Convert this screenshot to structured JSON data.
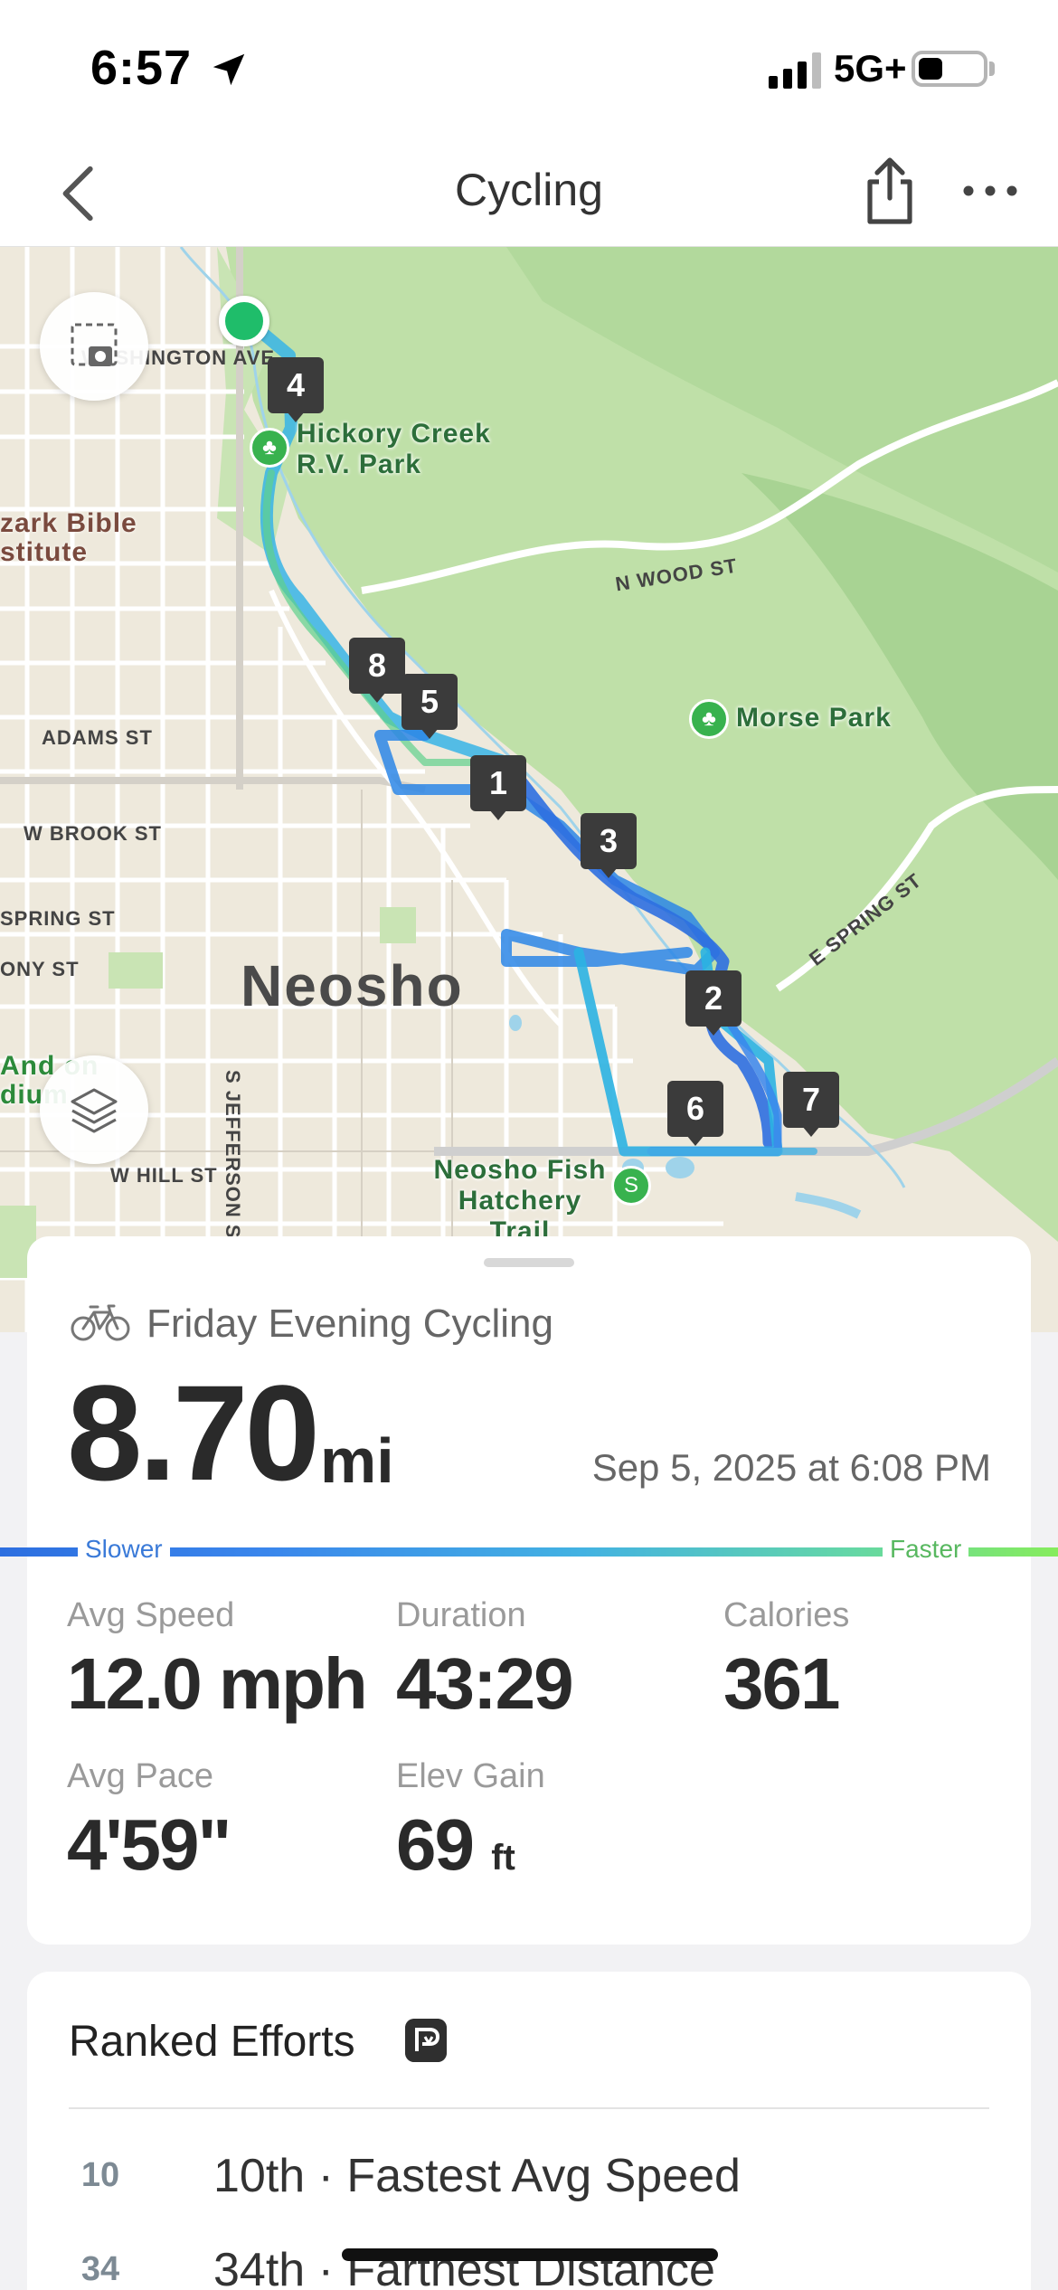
{
  "status_bar": {
    "time": "6:57",
    "network": "5G+"
  },
  "nav": {
    "title": "Cycling",
    "icons": [
      "chevron-left-icon",
      "share-icon",
      "more-icon"
    ]
  },
  "map": {
    "streets": [
      "WASHINGTON AVE",
      "N WOOD ST",
      "ADAMS ST",
      "W BROOK ST",
      "SPRING ST",
      "ONY ST",
      "W HILL ST",
      "S JEFFERSON S",
      "E SPRING ST"
    ],
    "city": "Neosho",
    "pois": [
      "Hickory Creek R.V. Park",
      "Morse Park",
      "Neosho Fish Hatchery Trail"
    ],
    "institution": "zark Bible stitute",
    "institution2": "And on dium",
    "lap_markers": [
      "4",
      "8",
      "5",
      "1",
      "3",
      "2",
      "6",
      "7"
    ],
    "icons": [
      "screenshot-icon",
      "layers-icon"
    ]
  },
  "summary": {
    "activity_name": "Friday Evening Cycling",
    "distance": "8.70",
    "distance_unit": "mi",
    "date": "Sep 5, 2025 at 6:08 PM",
    "legend_slower": "Slower",
    "legend_faster": "Faster",
    "stats": {
      "avg_speed": {
        "label": "Avg Speed",
        "value": "12.0 mph"
      },
      "duration": {
        "label": "Duration",
        "value": "43:29"
      },
      "calories": {
        "label": "Calories",
        "value": "361"
      },
      "avg_pace": {
        "label": "Avg Pace",
        "value": "4'59\""
      },
      "elev_gain": {
        "label": "Elev Gain",
        "value": "69",
        "unit": "ft"
      }
    }
  },
  "ranked": {
    "title": "Ranked Efforts",
    "items": [
      {
        "rank": "10",
        "text": "10th · Fastest Avg Speed"
      },
      {
        "rank": "34",
        "text": "34th · Farthest Distance"
      }
    ]
  },
  "colors": {
    "route_fast": "#86ec5c",
    "route_slow": "#2d6fe0",
    "route_mid": "#43b2e2",
    "park_green": "#a6d69a"
  }
}
